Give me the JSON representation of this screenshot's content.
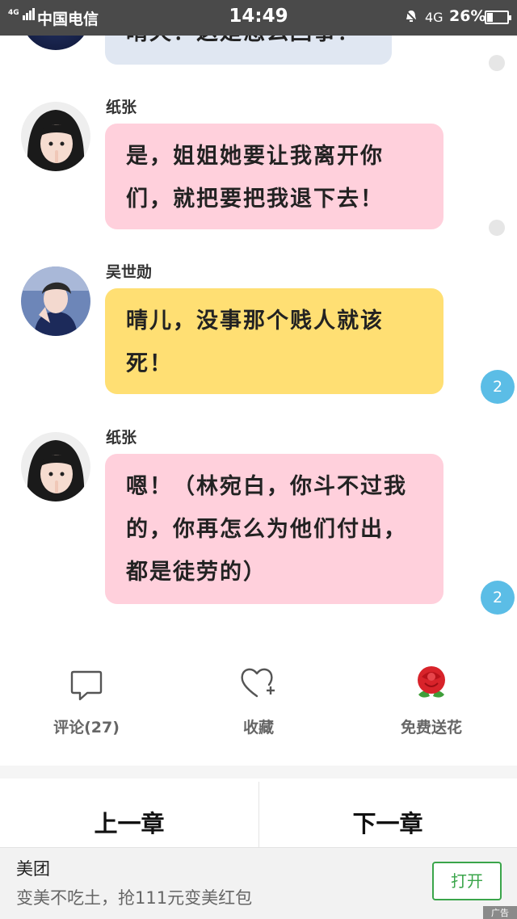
{
  "status_bar": {
    "signal": "4G",
    "carrier": "中国电信",
    "time": "14:49",
    "network": "4G",
    "battery": "26%",
    "battery_level": 0.26
  },
  "messages": [
    {
      "author": "",
      "text": "晴天！这是怎么回事！",
      "color": "blue"
    },
    {
      "author": "纸张",
      "text": "是，姐姐她要让我离开你们，就把要把我退下去！",
      "color": "pink",
      "avatar": "girl-avatar"
    },
    {
      "author": "吴世勋",
      "text": "晴儿，没事那个贱人就该死！",
      "color": "yellow",
      "avatar": "boy-avatar",
      "badge": "2"
    },
    {
      "author": "纸张",
      "text": "嗯！（林宛白，你斗不过我的，你再怎么为他们付出，都是徒劳的）",
      "color": "pink",
      "avatar": "girl-avatar",
      "badge": "2"
    }
  ],
  "actions": {
    "comment_label": "评论(27)",
    "favorite_label": "收藏",
    "flower_label": "免费送花"
  },
  "chapter_nav": {
    "prev_label": "上一章",
    "next_label": "下一章"
  },
  "ad": {
    "title": "美团",
    "description": "变美不吃土，抢111元变美红包",
    "open_label": "打开",
    "tag": "广告"
  },
  "colors": {
    "pink_bubble": "#ffd0dc",
    "yellow_bubble": "#ffdf73",
    "badge_blue": "#5bbde6",
    "accent_green": "#3aa54a",
    "status_bar": "#4a4a4a"
  }
}
